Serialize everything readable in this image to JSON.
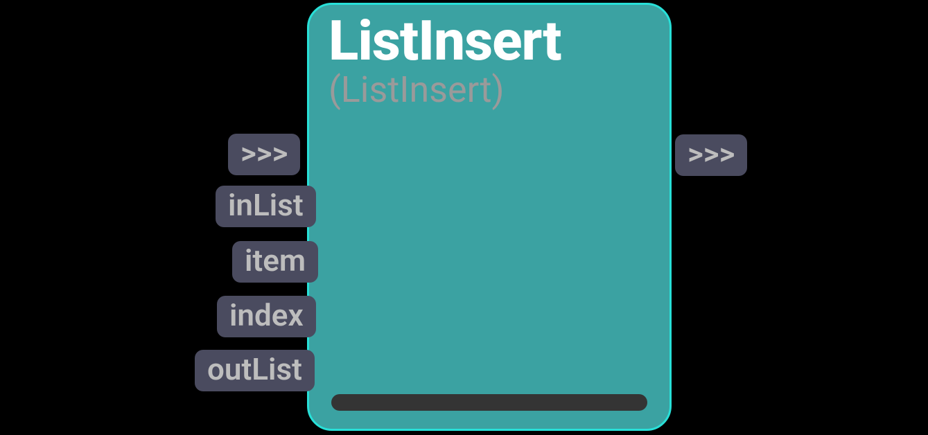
{
  "node": {
    "title": "ListInsert",
    "subtitle": "(ListInsert)",
    "inputs": [
      {
        "label": ">>>",
        "name": "exec-in"
      },
      {
        "label": "inList",
        "name": "inList"
      },
      {
        "label": "item",
        "name": "item"
      },
      {
        "label": "index",
        "name": "index"
      },
      {
        "label": "outList",
        "name": "outList"
      }
    ],
    "outputs": [
      {
        "label": ">>>",
        "name": "exec-out"
      }
    ]
  },
  "colors": {
    "node_bg": "#3ba2a2",
    "node_border": "#28e0d8",
    "port_bg": "#4a4b5f",
    "port_text": "#bdbdbd",
    "title_text": "#ffffff",
    "subtitle_text": "#9a9a9a",
    "footer_bar": "#343434",
    "canvas_bg": "#000000"
  }
}
